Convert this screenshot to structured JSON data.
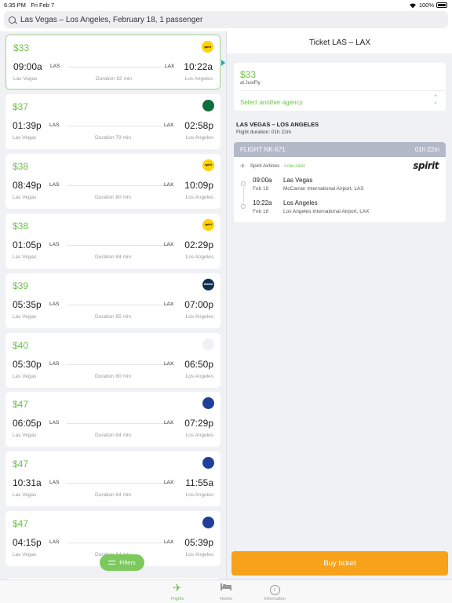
{
  "status_bar": {
    "time": "6:35 PM",
    "date": "Fri Feb 7",
    "battery": "100%",
    "wifi_icon": "wifi-icon",
    "battery_icon": "battery-icon"
  },
  "search": {
    "query": "Las Vegas – Los Angeles, February 18, 1 passenger",
    "icon": "search-icon"
  },
  "results": [
    {
      "price": "$33",
      "airline": "spirit",
      "logo_text": "spirit",
      "logo_bg": "#ffd200",
      "logo_fg": "#000000",
      "dep_time": "09:00a",
      "dep_code": "LAS",
      "arr_code": "LAX",
      "arr_time": "10:22a",
      "dep_city": "Las Vegas",
      "duration": "Duration 82 min",
      "arr_city": "Los Angeles"
    },
    {
      "price": "$37",
      "airline": "frontier",
      "logo_text": "",
      "logo_bg": "#0b6e3b",
      "logo_fg": "#ffffff",
      "dep_time": "01:39p",
      "dep_code": "LAS",
      "arr_code": "LAX",
      "arr_time": "02:58p",
      "dep_city": "Las Vegas",
      "duration": "Duration 79 min",
      "arr_city": "Los Angeles"
    },
    {
      "price": "$38",
      "airline": "spirit",
      "logo_text": "spirit",
      "logo_bg": "#ffd200",
      "logo_fg": "#000000",
      "dep_time": "08:49p",
      "dep_code": "LAS",
      "arr_code": "LAX",
      "arr_time": "10:09p",
      "dep_city": "Las Vegas",
      "duration": "Duration 80 min",
      "arr_city": "Los Angeles"
    },
    {
      "price": "$38",
      "airline": "spirit",
      "logo_text": "spirit",
      "logo_bg": "#ffd200",
      "logo_fg": "#000000",
      "dep_time": "01:05p",
      "dep_code": "LAS",
      "arr_code": "LAX",
      "arr_time": "02:29p",
      "dep_city": "Las Vegas",
      "duration": "Duration 84 min",
      "arr_city": "Los Angeles"
    },
    {
      "price": "$39",
      "airline": "alaska",
      "logo_text": "Alaska",
      "logo_bg": "#0c2f52",
      "logo_fg": "#ffffff",
      "dep_time": "05:35p",
      "dep_code": "LAS",
      "arr_code": "LAX",
      "arr_time": "07:00p",
      "dep_city": "Las Vegas",
      "duration": "Duration 85 min",
      "arr_city": "Los Angeles"
    },
    {
      "price": "$40",
      "airline": "american",
      "logo_text": "",
      "logo_bg": "#eef1f5",
      "logo_fg": "#c8102e",
      "dep_time": "05:30p",
      "dep_code": "LAS",
      "arr_code": "LAX",
      "arr_time": "06:50p",
      "dep_city": "Las Vegas",
      "duration": "Duration 80 min",
      "arr_city": "Los Angeles"
    },
    {
      "price": "$47",
      "airline": "united",
      "logo_text": "",
      "logo_bg": "#1f3f9a",
      "logo_fg": "#ffffff",
      "dep_time": "06:05p",
      "dep_code": "LAS",
      "arr_code": "LAX",
      "arr_time": "07:29p",
      "dep_city": "Las Vegas",
      "duration": "Duration 84 min",
      "arr_city": "Los Angeles"
    },
    {
      "price": "$47",
      "airline": "united",
      "logo_text": "",
      "logo_bg": "#1f3f9a",
      "logo_fg": "#ffffff",
      "dep_time": "10:31a",
      "dep_code": "LAS",
      "arr_code": "LAX",
      "arr_time": "11:55a",
      "dep_city": "Las Vegas",
      "duration": "Duration 84 min",
      "arr_city": "Los Angeles"
    },
    {
      "price": "$47",
      "airline": "united",
      "logo_text": "",
      "logo_bg": "#1f3f9a",
      "logo_fg": "#ffffff",
      "dep_time": "04:15p",
      "dep_code": "LAS",
      "arr_code": "LAX",
      "arr_time": "05:39p",
      "dep_city": "Las Vegas",
      "duration": "Duration 84 min",
      "arr_city": "Los Angeles"
    }
  ],
  "filters_button": {
    "label": "Filters",
    "icon": "sliders-icon"
  },
  "details": {
    "header": "Ticket LAS – LAX",
    "price": "$33",
    "agency": "at JustFly",
    "select_agency": "Select another agency",
    "route_title": "LAS VEGAS – LOS ANGELES",
    "route_duration": "Flight duration: 01h 22m",
    "flight_number": "FLIGHT NK-671",
    "flight_time": "01h 22m",
    "airline_name": "Spirit Airlines",
    "airline_tag": "Low-cost",
    "airline_logo_text": "spirit",
    "departure": {
      "time": "09:00a",
      "date": "Feb 18",
      "city": "Las Vegas",
      "airport": "McCarran International Airport, LAS"
    },
    "arrival": {
      "time": "10:22a",
      "date": "Feb 18",
      "city": "Los Angeles",
      "airport": "Los Angeles International Airport, LAX"
    },
    "buy_button": "Buy ticket"
  },
  "tabs": [
    {
      "label": "Flights",
      "icon": "plane-icon",
      "active": true
    },
    {
      "label": "Hotels",
      "icon": "bed-icon",
      "active": false
    },
    {
      "label": "Information",
      "icon": "info-icon",
      "active": false
    }
  ],
  "colors": {
    "accent_green": "#6cc24a",
    "buy_orange": "#f7a21a",
    "flight_header": "#b4b9c8"
  }
}
